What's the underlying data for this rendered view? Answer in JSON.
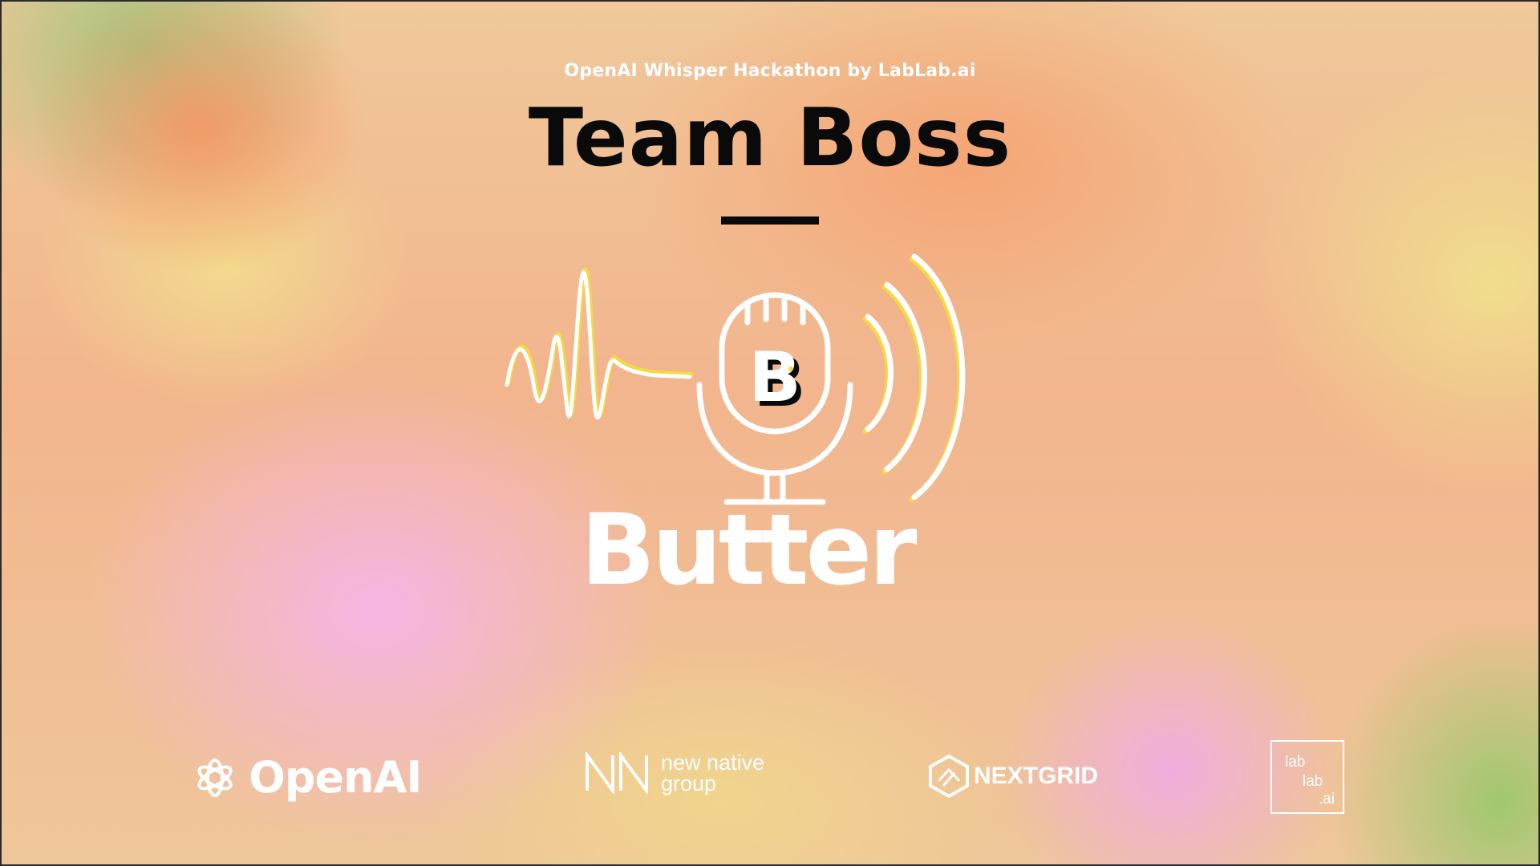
{
  "slide": {
    "event_title": "OpenAI Whisper Hackathon by LabLab.ai",
    "team_name": "Team Boss",
    "logo": {
      "monogram": "B",
      "wordmark": "Butter",
      "icons": [
        "sound-wave-icon",
        "microphone-icon",
        "sound-arcs-icon"
      ]
    },
    "sponsors": {
      "openai": "OpenAI",
      "new_native": "new native\ngroup",
      "nextgrid": "NEXTGRID",
      "lablab": [
        "lab",
        "lab",
        ".ai"
      ]
    },
    "colors": {
      "text_dark": "#0a0a0a",
      "logo_white": "#ffffff",
      "logo_accent_yellow": "#f3d943"
    }
  }
}
